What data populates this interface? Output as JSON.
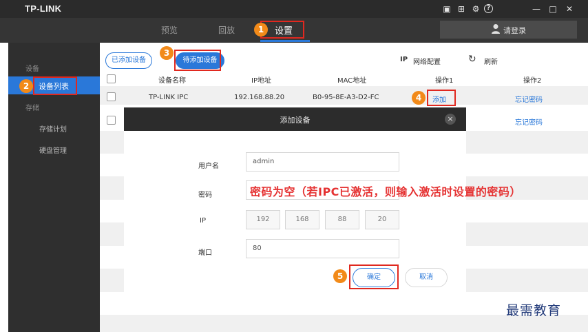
{
  "app": {
    "logo": "TP-LINK"
  },
  "titlebar": {
    "icons": [
      "monitor-icon",
      "grid-icon",
      "gear-icon",
      "help-icon",
      "minimize-icon",
      "maximize-icon",
      "close-icon"
    ],
    "glyphs": {
      "monitor": "▣",
      "grid": "⊞",
      "gear": "⚙",
      "help": "?",
      "minimize": "—",
      "maximize": "□",
      "close": "✕"
    }
  },
  "nav": {
    "tabs": [
      {
        "label": "预览"
      },
      {
        "label": "回放"
      },
      {
        "label": "设置"
      }
    ],
    "login_label": "请登录"
  },
  "sidebar": {
    "section_device": "设备",
    "item_device_list": "设备列表",
    "section_storage": "存储",
    "item_storage_plan": "存储计划",
    "item_disk_mgmt": "硬盘管理"
  },
  "toolbar": {
    "tab_added": "已添加设备",
    "tab_pending": "待添加设备",
    "ip_config_prefix": "IP",
    "ip_config_label": "网络配置",
    "refresh_icon": "↻",
    "refresh_label": "刷新"
  },
  "table": {
    "headers": [
      "设备名称",
      "IP地址",
      "MAC地址",
      "操作1",
      "操作2"
    ],
    "rows": [
      {
        "name": "TP-LINK IPC",
        "ip": "192.168.88.20",
        "mac": "B0-95-8E-A3-D2-FC",
        "op1": "添加",
        "op2": "忘记密码"
      },
      {
        "name": "",
        "ip": "",
        "mac": "",
        "op1": "",
        "op2": "忘记密码"
      }
    ]
  },
  "dialog": {
    "title": "添加设备",
    "close": "×",
    "username_label": "用户名",
    "username_value": "admin",
    "password_label": "密码",
    "ip_label": "IP",
    "ip_octets": [
      "192",
      "168",
      "88",
      "20"
    ],
    "port_label": "端口",
    "port_value": "80",
    "confirm_label": "确定",
    "cancel_label": "取消"
  },
  "annotation": {
    "password_note": "密码为空（若IPC已激活，则输入激活时设置的密码）",
    "steps": [
      "1",
      "2",
      "3",
      "4",
      "5"
    ]
  },
  "watermark": "最需教育",
  "colors": {
    "accent": "#2a78d9",
    "annotation_red": "#e0281f",
    "step_badge": "#f28a19",
    "titlebar": "#2b2b2b",
    "sidebar": "#2f2f2f"
  }
}
